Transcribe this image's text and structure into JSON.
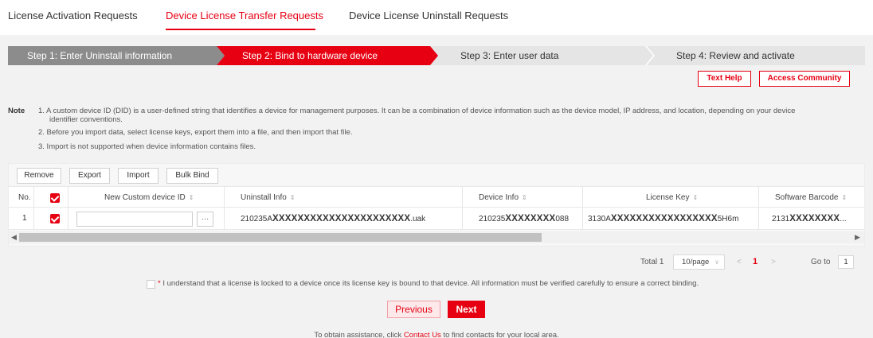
{
  "tabs": [
    {
      "label": "License Activation Requests"
    },
    {
      "label": "Device License Transfer Requests"
    },
    {
      "label": "Device License Uninstall Requests"
    }
  ],
  "steps": [
    {
      "label": "Step 1: Enter Uninstall information"
    },
    {
      "label": "Step 2: Bind to hardware device"
    },
    {
      "label": "Step 3: Enter user data"
    },
    {
      "label": "Step 4: Review and activate"
    }
  ],
  "help": {
    "text_help": "Text Help",
    "access_community": "Access Community"
  },
  "note": {
    "label": "Note",
    "lines": [
      "1. A custom device ID (DID) is a user-defined string that identifies a device for management purposes. It can be a combination of device information such as the device model, IP address, and location, depending on your device",
      "identifier conventions.",
      "2. Before you import data, select license keys, export them into a file, and then import that file.",
      "3. Import is not supported when device information contains files."
    ]
  },
  "toolbar": {
    "remove": "Remove",
    "export": "Export",
    "import": "Import",
    "bulk_bind": "Bulk Bind"
  },
  "table": {
    "headers": {
      "no": "No.",
      "custom_id": "New Custom device ID",
      "uninstall": "Uninstall Info",
      "device": "Device Info",
      "license": "License Key",
      "barcode": "Software Barcode"
    },
    "sort_icon": "⇕",
    "rows": [
      {
        "no": "1",
        "custom_id": "",
        "browse": "…",
        "uninstall_pre": "210235A",
        "uninstall_mask": "XXXXXXXXXXXXXXXXXXXXXX",
        "uninstall_post": ".uak",
        "device_pre": "210235",
        "device_mask": "XXXXXXXX",
        "device_post": "088",
        "license_pre": "3130A",
        "license_mask": "XXXXXXXXXXXXXXXXX",
        "license_post": "5H6m",
        "barcode_pre": "2131",
        "barcode_mask": "XXXXXXXX",
        "barcode_post": "..."
      }
    ]
  },
  "pagination": {
    "total_label": "Total 1",
    "page_size": "10/page",
    "prev": "<",
    "current": "1",
    "next": ">",
    "goto_label": "Go to",
    "goto_value": "1"
  },
  "agreement": {
    "required_mark": "*",
    "text": "I understand that a license is locked to a device once its license key is bound to that device. All information must be verified carefully to ensure a correct binding."
  },
  "nav": {
    "previous": "Previous",
    "next": "Next"
  },
  "assistance": {
    "pre": "To obtain assistance, click ",
    "link": "Contact Us",
    "post": " to find contacts for your local area."
  },
  "colors": {
    "accent": "#e60012",
    "step_done": "#8c8c8c",
    "step_pending": "#e5e5e5"
  }
}
